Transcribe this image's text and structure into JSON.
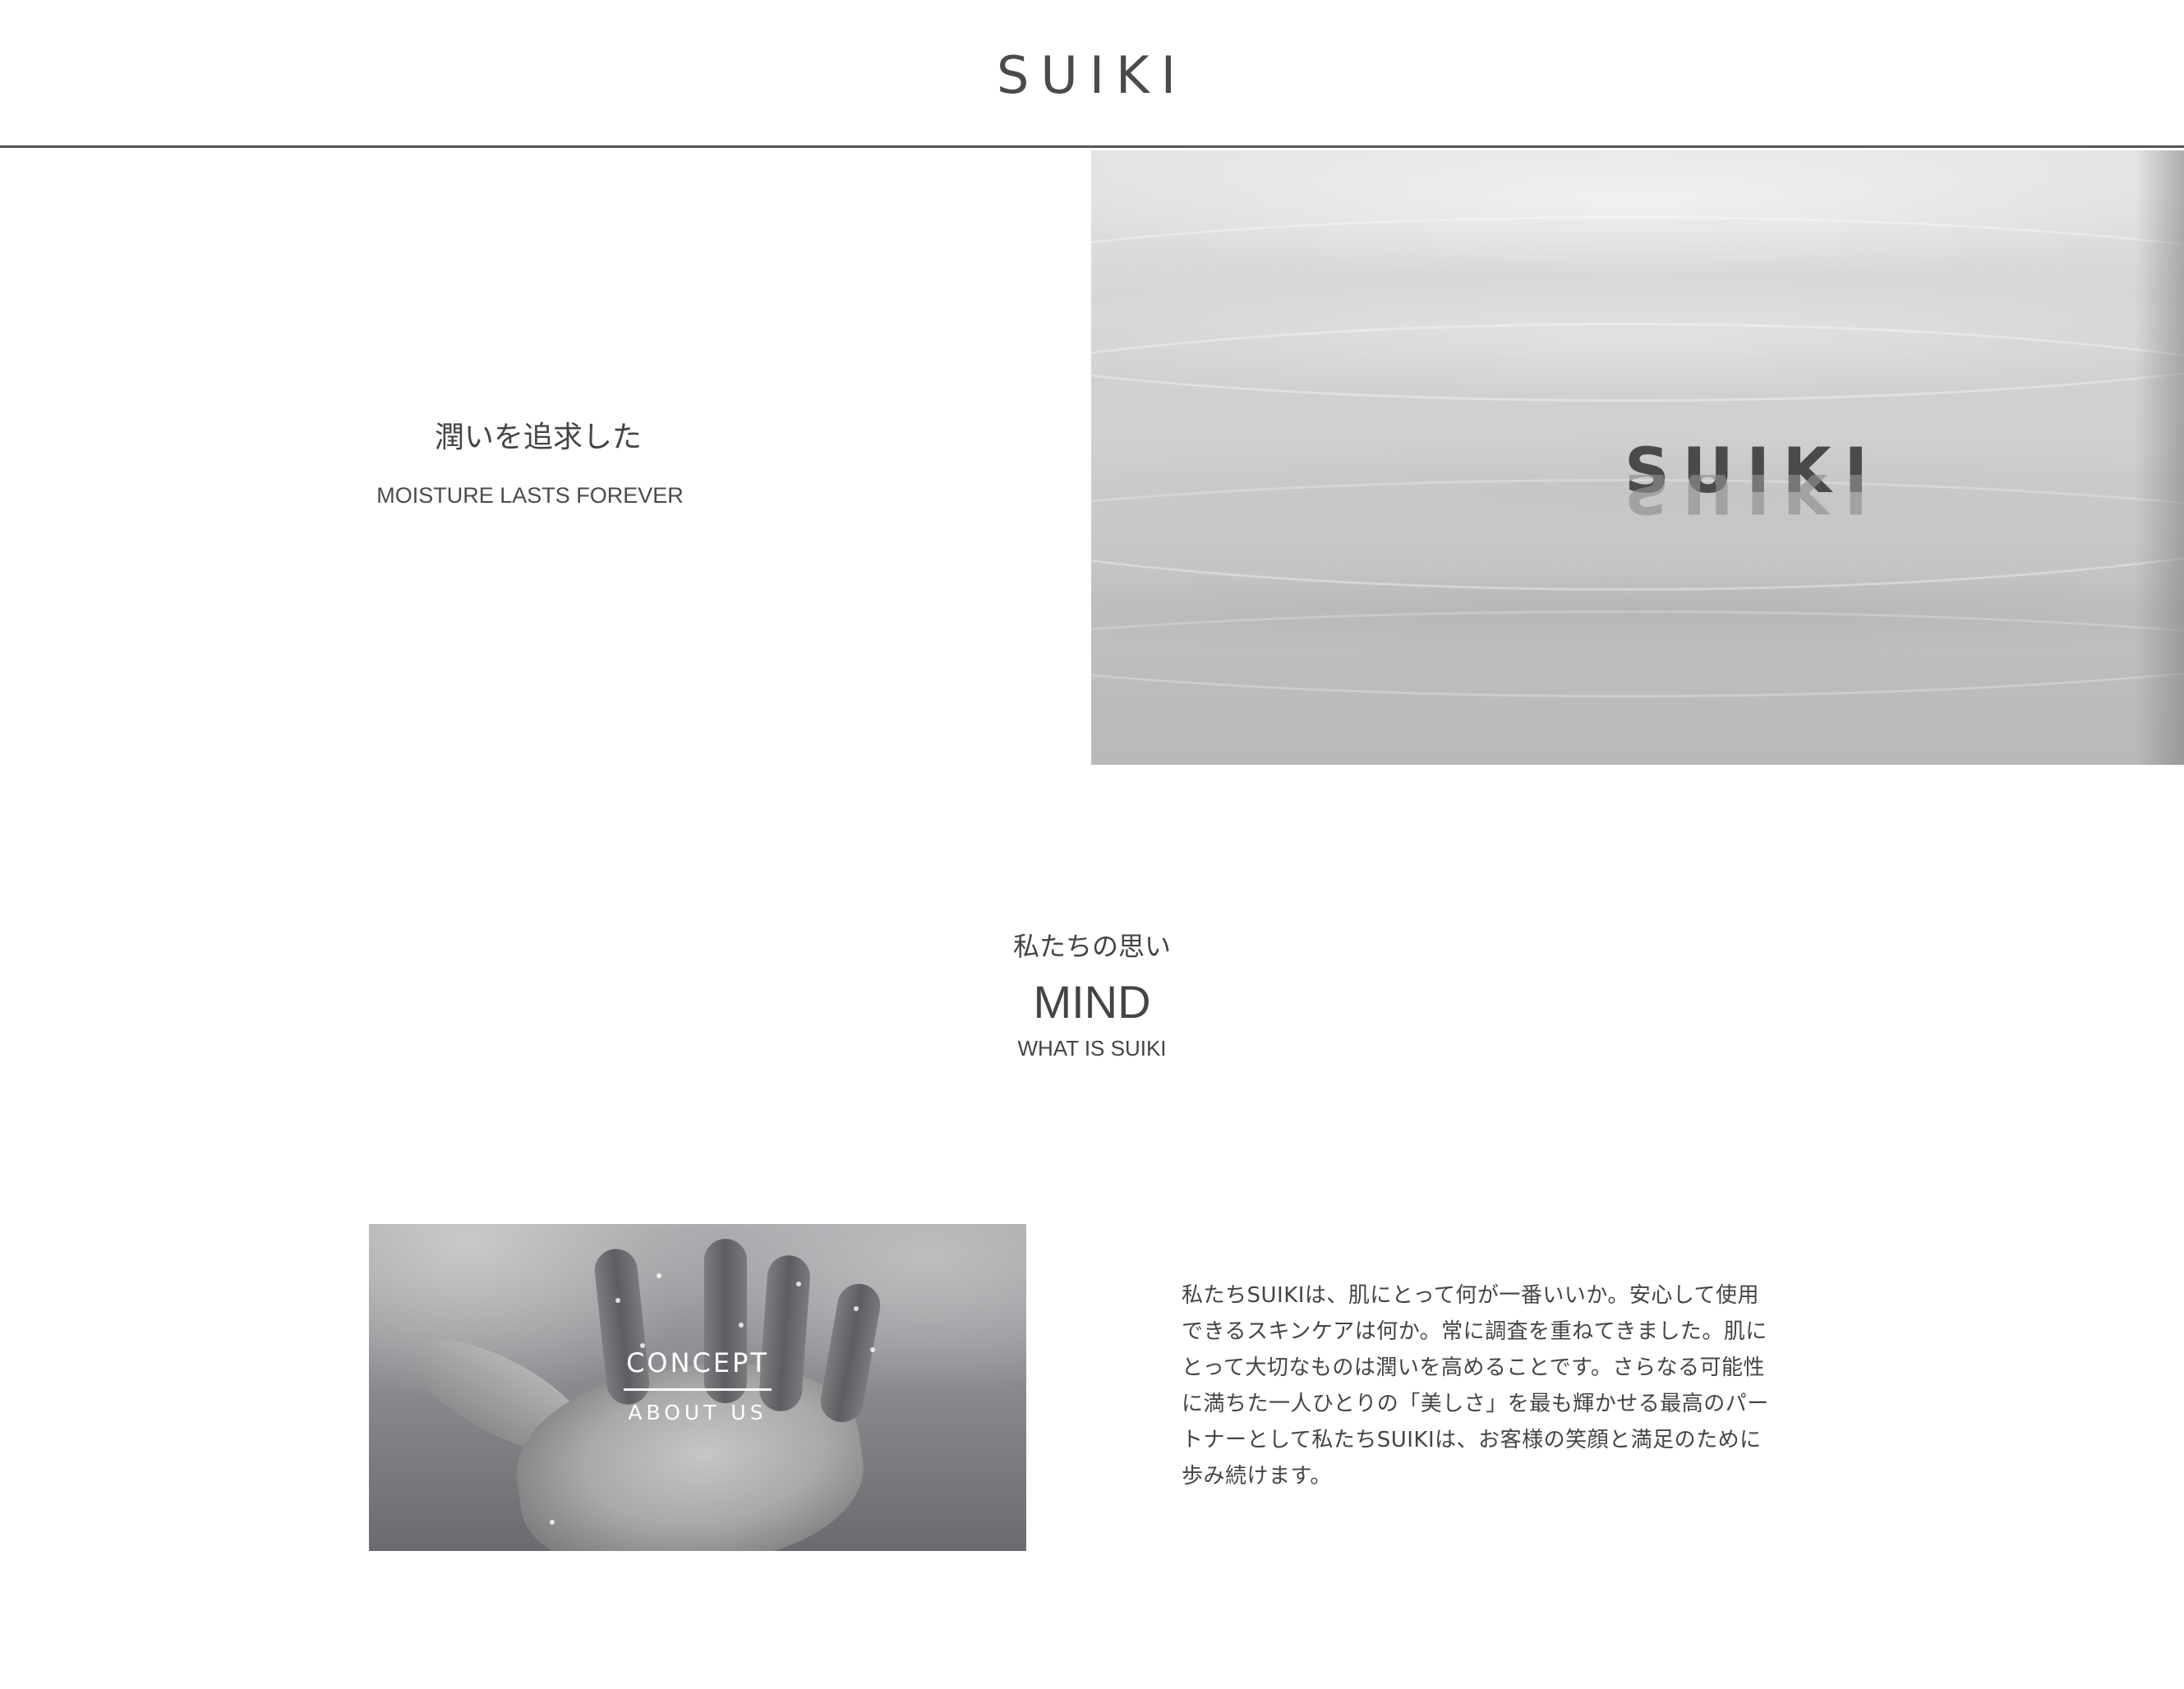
{
  "header": {
    "logo": "SUIKI"
  },
  "hero": {
    "title_ja": "潤いを追求した",
    "subtitle": "MOISTURE LASTS FOREVER",
    "image_brand": "SUIKI"
  },
  "mind": {
    "title_ja": "私たちの思い",
    "title": "MIND",
    "subtitle": "WHAT IS SUIKI",
    "card": {
      "label": "CONCEPT",
      "sublabel": "ABOUT US"
    },
    "body": [
      "私たちSUIKIは、肌にとって何が一番いいか。安心して使用",
      "できるスキンケアは何か。常に調査を重ねてきました。肌に",
      "とって大切なものは潤いを高めることです。さらなる可能性",
      "に満ちた一人ひとりの「美しさ」を最も輝かせる最高のパー",
      "トナーとして私たちSUIKIは、お客様の笑顔と満足のために",
      "歩み続けます。"
    ]
  },
  "colors": {
    "text": "#444444",
    "header_border": "#555555",
    "background": "#ffffff"
  }
}
